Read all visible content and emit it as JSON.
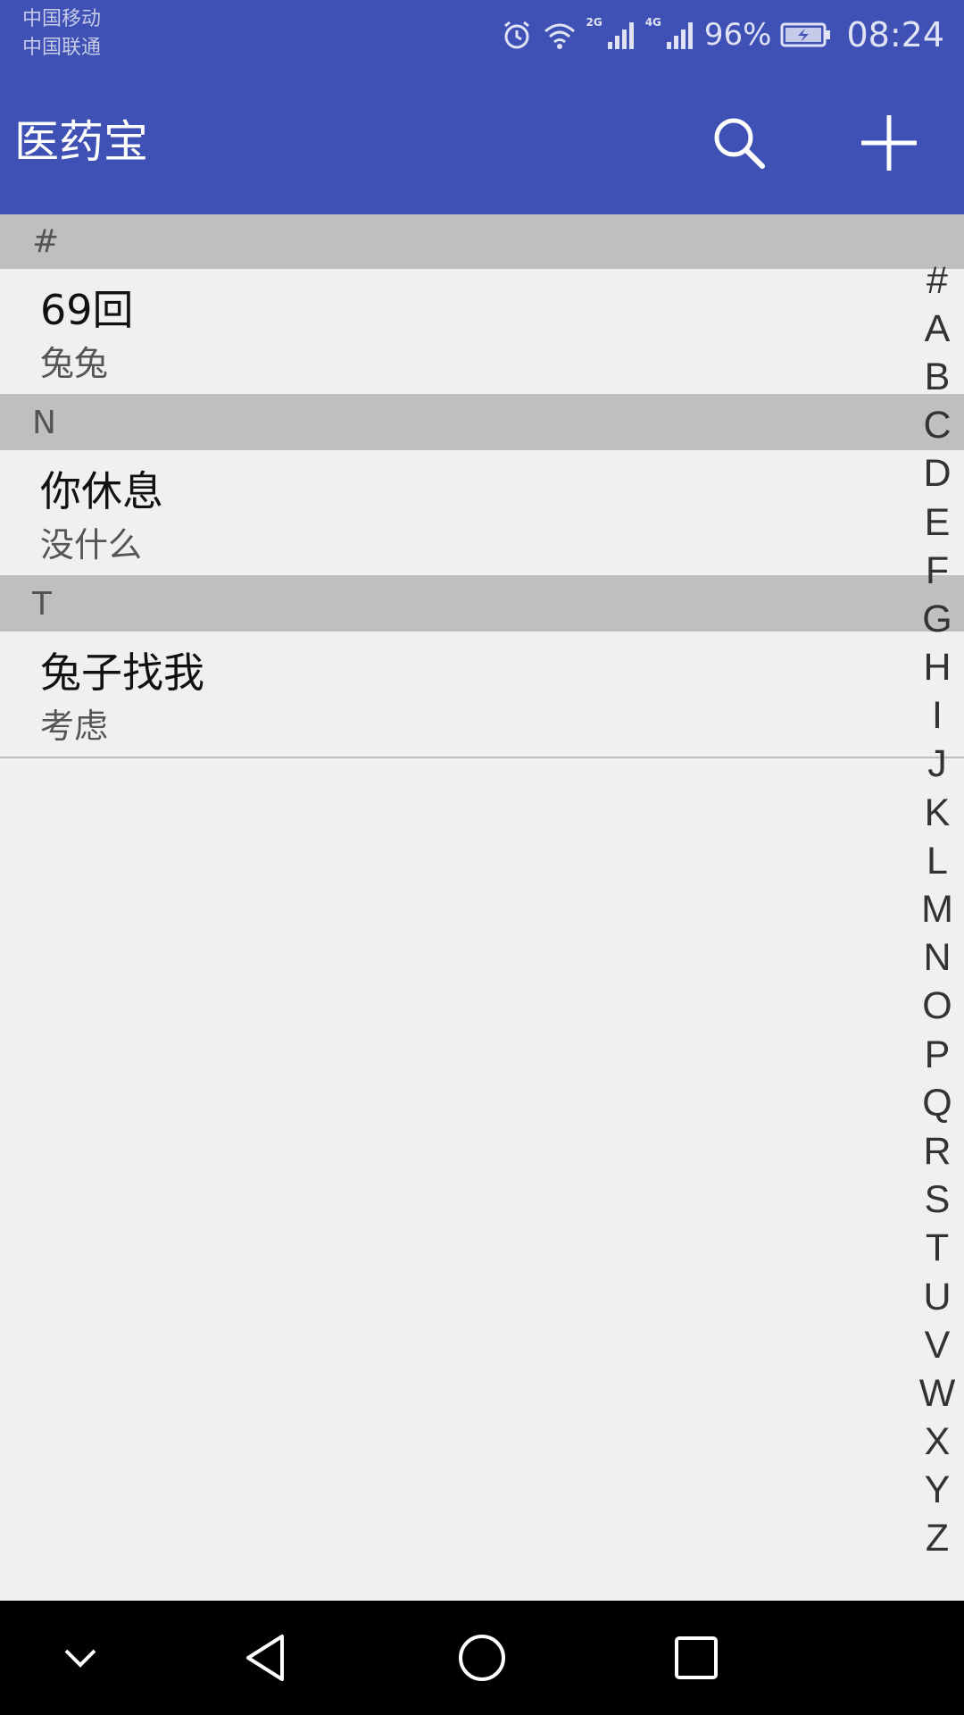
{
  "status_bar": {
    "carriers": [
      "中国移动",
      "中国联通"
    ],
    "network_tags": [
      "2G",
      "4G"
    ],
    "battery": "96%",
    "time": "08:24",
    "icons": [
      "alarm-icon",
      "wifi-icon",
      "signal-icon",
      "signal-icon",
      "battery-charging-icon"
    ]
  },
  "app_bar": {
    "title": "医药宝",
    "actions": [
      "search-icon",
      "add-icon"
    ]
  },
  "sections": [
    {
      "header": "#",
      "items": [
        {
          "title": "69回",
          "subtitle": "兔兔"
        }
      ]
    },
    {
      "header": "N",
      "items": [
        {
          "title": "你休息",
          "subtitle": "没什么"
        }
      ]
    },
    {
      "header": "T",
      "items": [
        {
          "title": "兔子找我",
          "subtitle": "考虑"
        }
      ]
    }
  ],
  "index_letters": [
    "#",
    "A",
    "B",
    "C",
    "D",
    "E",
    "F",
    "G",
    "H",
    "I",
    "J",
    "K",
    "L",
    "M",
    "N",
    "O",
    "P",
    "Q",
    "R",
    "S",
    "T",
    "U",
    "V",
    "W",
    "X",
    "Y",
    "Z"
  ],
  "nav_bar": {
    "buttons": [
      "chevron-down-icon",
      "back-icon",
      "home-icon",
      "recents-icon"
    ]
  },
  "colors": {
    "primary": "#3f51b5",
    "section_header": "#c0bfbf",
    "background": "#f0f0f0"
  }
}
